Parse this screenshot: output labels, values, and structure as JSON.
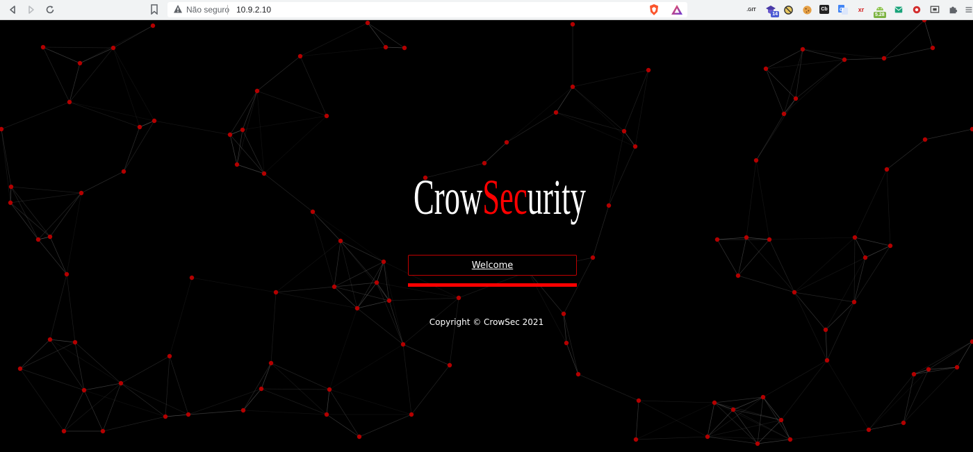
{
  "browser": {
    "security_label": "Não seguro",
    "url": "10.9.2.10",
    "extensions": [
      {
        "name": "git-extension-icon",
        "text": ".GIT"
      },
      {
        "name": "ublock-icon",
        "text": "",
        "badge": "14"
      },
      {
        "name": "blocked-icon",
        "text": ""
      },
      {
        "name": "cookie-icon",
        "text": ""
      },
      {
        "name": "cb-extension-icon",
        "text": "Cb"
      },
      {
        "name": "translate-icon",
        "text": ""
      },
      {
        "name": "xr-extension-icon",
        "text": "xr"
      },
      {
        "name": "android-icon",
        "text": "",
        "badge": "5.28"
      },
      {
        "name": "mail-icon",
        "text": ""
      },
      {
        "name": "record-icon",
        "text": ""
      },
      {
        "name": "screen-icon",
        "text": ""
      },
      {
        "name": "puzzle-icon",
        "text": ""
      },
      {
        "name": "menu-icon",
        "text": ""
      }
    ]
  },
  "page": {
    "logo_part1": "Crow",
    "logo_part2": "Sec",
    "logo_part3": "urity",
    "welcome_button": "Welcome",
    "copyright": "Copyright © CrowSec 2021"
  },
  "colors": {
    "accent": "#ff0000",
    "background": "#000000",
    "node": "#b30000"
  }
}
